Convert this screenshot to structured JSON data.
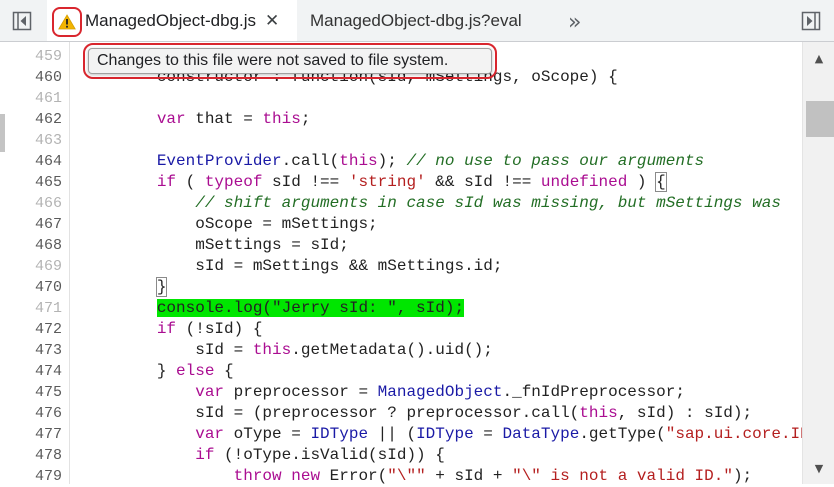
{
  "tabs": {
    "active_label": "ManagedObject-dbg.js",
    "inactive_label": "ManagedObject-dbg.js?eval",
    "close_glyph": "✕",
    "overflow_glyph": "»",
    "warning_icon": "warning-triangle-icon"
  },
  "tooltip": {
    "text": "Changes to this file were not saved to file system."
  },
  "editor": {
    "line_numbers": [
      "459",
      "460",
      "461",
      "462",
      "463",
      "464",
      "465",
      "466",
      "467",
      "468",
      "469",
      "470",
      "471",
      "472",
      "473",
      "474",
      "475",
      "476",
      "477",
      "478",
      "479"
    ],
    "dim_lines": [
      "459",
      "461",
      "463",
      "466",
      "469",
      "471"
    ],
    "highlighted_line": "471",
    "lines": [
      [
        {
          "t": "",
          "c": ""
        }
      ],
      [
        {
          "t": "        constructor : function(sId, mSettings, oScope) {",
          "c": ""
        }
      ],
      [
        {
          "t": "",
          "c": ""
        }
      ],
      [
        {
          "t": "\t\tvar",
          "c": "kw"
        },
        {
          "t": " that = ",
          "c": ""
        },
        {
          "t": "this",
          "c": "kw"
        },
        {
          "t": ";",
          "c": ""
        }
      ],
      [
        {
          "t": "",
          "c": ""
        }
      ],
      [
        {
          "t": "\t\tEventProvider",
          "c": "fn"
        },
        {
          "t": ".call(",
          "c": ""
        },
        {
          "t": "this",
          "c": "kw"
        },
        {
          "t": "); ",
          "c": ""
        },
        {
          "t": "// no use to pass our arguments",
          "c": "cm"
        }
      ],
      [
        {
          "t": "\t\tif",
          "c": "kw"
        },
        {
          "t": " ( ",
          "c": ""
        },
        {
          "t": "typeof",
          "c": "kw"
        },
        {
          "t": " sId !== ",
          "c": ""
        },
        {
          "t": "'string'",
          "c": "str"
        },
        {
          "t": " && sId !== ",
          "c": ""
        },
        {
          "t": "undefined",
          "c": "kw"
        },
        {
          "t": " ) ",
          "c": ""
        },
        {
          "t": "{",
          "c": "bracket-box"
        }
      ],
      [
        {
          "t": "\t\t\t",
          "c": ""
        },
        {
          "t": "// shift arguments in case sId was missing, but mSettings was",
          "c": "cm"
        }
      ],
      [
        {
          "t": "\t\t\toScope = mSettings;",
          "c": ""
        }
      ],
      [
        {
          "t": "\t\t\tmSettings = sId;",
          "c": ""
        }
      ],
      [
        {
          "t": "\t\t\tsId = mSettings && mSettings.id;",
          "c": ""
        }
      ],
      [
        {
          "t": "\t\t",
          "c": ""
        },
        {
          "t": "}",
          "c": "bracket-box"
        }
      ],
      [
        {
          "t": "\t\t",
          "c": ""
        },
        {
          "t": "console.log(\"Jerry sId: \", sId);",
          "c": "ln-hl"
        }
      ],
      [
        {
          "t": "\t\tif",
          "c": "kw"
        },
        {
          "t": " (!sId) {",
          "c": ""
        }
      ],
      [
        {
          "t": "\t\t\tsId = ",
          "c": ""
        },
        {
          "t": "this",
          "c": "kw"
        },
        {
          "t": ".getMetadata().uid();",
          "c": ""
        }
      ],
      [
        {
          "t": "\t\t} ",
          "c": ""
        },
        {
          "t": "else",
          "c": "kw"
        },
        {
          "t": " {",
          "c": ""
        }
      ],
      [
        {
          "t": "\t\t\tvar",
          "c": "kw"
        },
        {
          "t": " preprocessor = ",
          "c": ""
        },
        {
          "t": "ManagedObject",
          "c": "fn"
        },
        {
          "t": "._fnIdPreprocessor;",
          "c": ""
        }
      ],
      [
        {
          "t": "\t\t\tsId = (preprocessor ? preprocessor.call(",
          "c": ""
        },
        {
          "t": "this",
          "c": "kw"
        },
        {
          "t": ", sId) : sId);",
          "c": ""
        }
      ],
      [
        {
          "t": "\t\t\tvar",
          "c": "kw"
        },
        {
          "t": " oType = ",
          "c": ""
        },
        {
          "t": "IDType",
          "c": "fn"
        },
        {
          "t": " || (",
          "c": ""
        },
        {
          "t": "IDType",
          "c": "fn"
        },
        {
          "t": " = ",
          "c": ""
        },
        {
          "t": "DataType",
          "c": "fn"
        },
        {
          "t": ".getType(",
          "c": ""
        },
        {
          "t": "\"sap.ui.core.ID\"",
          "c": "str"
        },
        {
          "t": ");",
          "c": ""
        }
      ],
      [
        {
          "t": "\t\t\tif",
          "c": "kw"
        },
        {
          "t": " (!oType.isValid(sId)) {",
          "c": ""
        }
      ],
      [
        {
          "t": "\t\t\t\tthrow new",
          "c": "kw"
        },
        {
          "t": " Error(",
          "c": ""
        },
        {
          "t": "\"\\\"\"",
          "c": "str"
        },
        {
          "t": " + sId + ",
          "c": ""
        },
        {
          "t": "\"\\\" is not a valid ID.\"",
          "c": "str"
        },
        {
          "t": ");",
          "c": ""
        }
      ]
    ]
  },
  "colors": {
    "highlight": "#00e600",
    "annotation_ring": "#d9262e",
    "keyword": "#aa0d91",
    "comment": "#236e25",
    "string": "#b41f1f"
  }
}
